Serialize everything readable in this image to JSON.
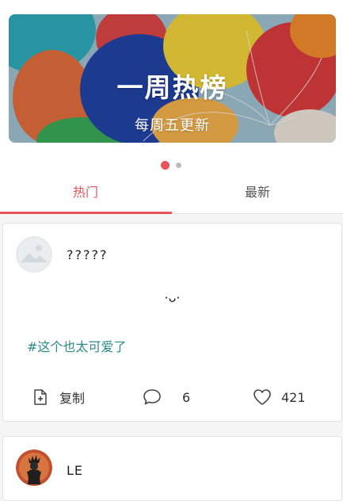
{
  "banner": {
    "title": "一周热榜",
    "subtitle": "每周五更新"
  },
  "tabs": [
    {
      "label": "热门",
      "active": true
    },
    {
      "label": "最新",
      "active": false
    }
  ],
  "colors": {
    "accent": "#e8525a",
    "hashtag": "#2a8a8c"
  },
  "posts": [
    {
      "username": "?????",
      "avatar_icon": "placeholder-image-icon",
      "text": "·ᴗ·",
      "hashtag": "#这个也太可爱了",
      "actions": {
        "copy_label": "复制",
        "comment_count": "6",
        "like_count": "421"
      }
    },
    {
      "username": "LE",
      "avatar_icon": "character-avatar"
    }
  ]
}
